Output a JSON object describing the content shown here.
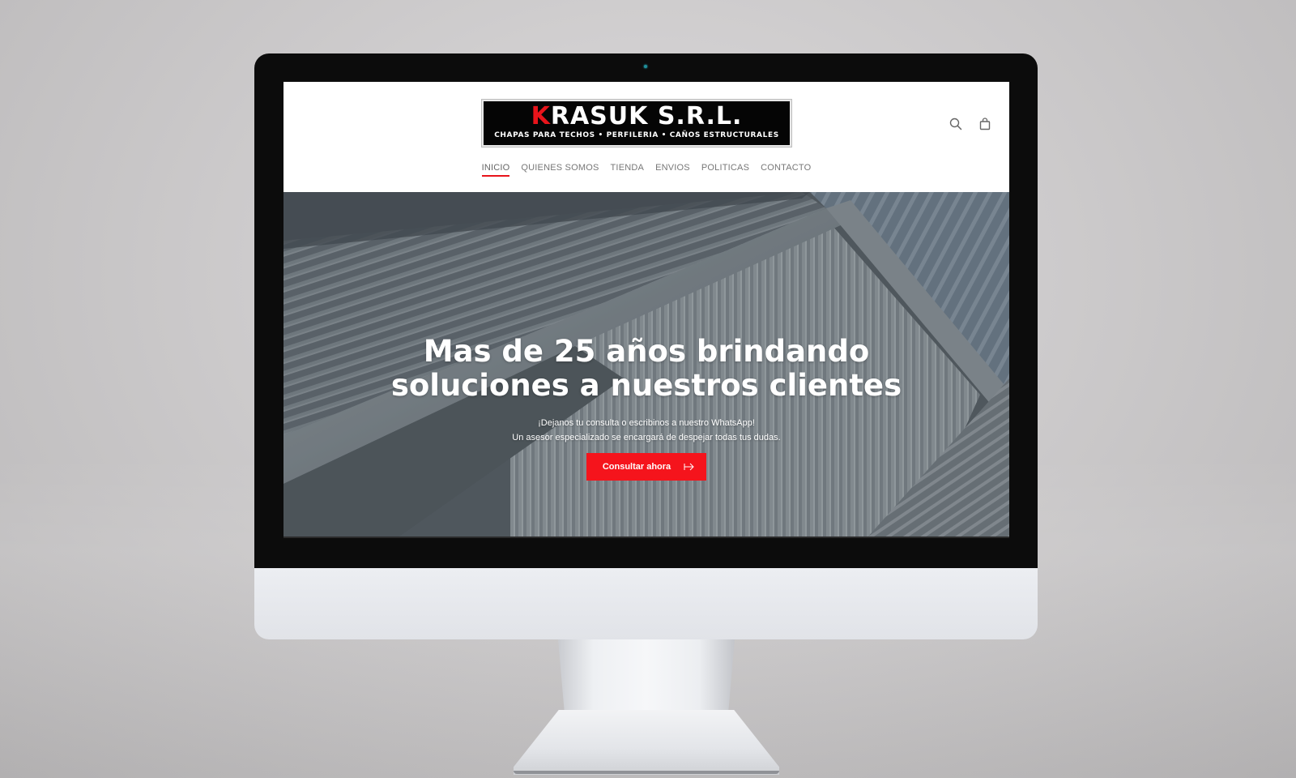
{
  "logo": {
    "title_first": "K",
    "title_rest": "RASUK S.R.L.",
    "subtitle": "CHAPAS PARA TECHOS • PERFILERIA • CAÑOS ESTRUCTURALES"
  },
  "header": {
    "icons": [
      "search-icon",
      "shopping-bag-icon"
    ]
  },
  "nav": {
    "items": [
      {
        "label": "INICIO",
        "active": true
      },
      {
        "label": "QUIENES SOMOS",
        "active": false
      },
      {
        "label": "TIENDA",
        "active": false
      },
      {
        "label": "ENVIOS",
        "active": false
      },
      {
        "label": "POLITICAS",
        "active": false
      },
      {
        "label": "CONTACTO",
        "active": false
      }
    ]
  },
  "hero": {
    "title": "Mas de 25 años brindando soluciones a nuestros clientes",
    "subtitle_line1": "¡Dejanos tu consulta o escribinos a nuestro WhatsApp!",
    "subtitle_line2": "Un asesor especializado se encargará de despejar todas tus dudas.",
    "cta_label": "Consultar ahora",
    "cta_icon": "arrow-right-icon"
  },
  "colors": {
    "accent": "#f5141c",
    "nav_text": "#777777",
    "bezel": "#0c0c0c"
  }
}
